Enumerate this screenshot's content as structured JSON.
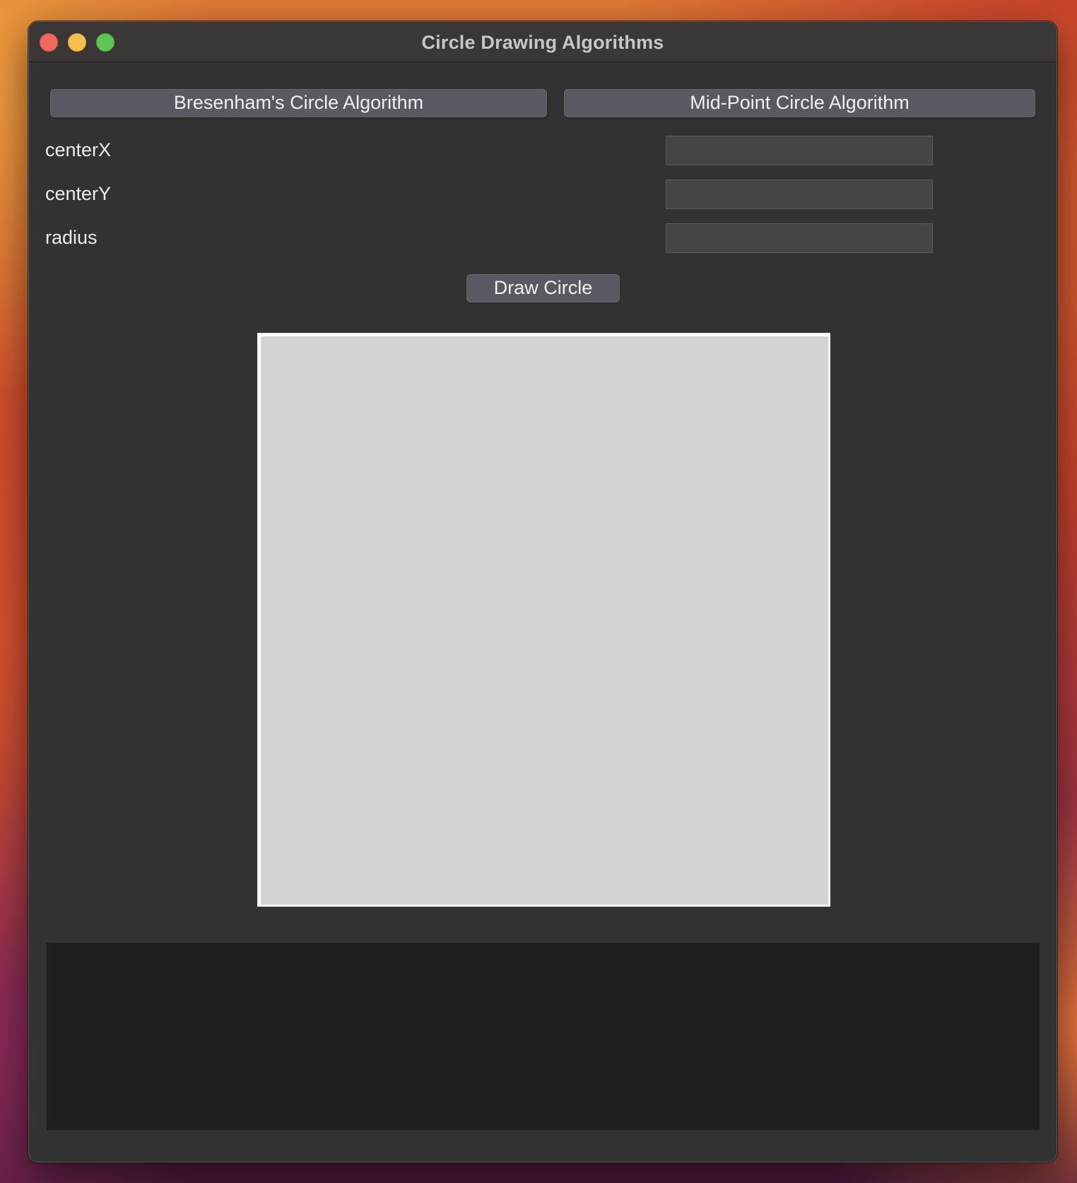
{
  "window": {
    "title": "Circle Drawing Algorithms"
  },
  "toolbar": {
    "bresenham_label": "Bresenham's Circle Algorithm",
    "midpoint_label": "Mid-Point Circle Algorithm"
  },
  "form": {
    "center_x_label": "centerX",
    "center_y_label": "centerY",
    "radius_label": "radius",
    "center_x_value": "",
    "center_y_value": "",
    "radius_value": "",
    "draw_label": "Draw Circle"
  },
  "colors": {
    "window_bg": "#323232",
    "canvas_bg": "#d4d4d4",
    "console_bg": "#1e1e1e",
    "close": "#ee6a5e",
    "minimize": "#f5bf4f",
    "maximize": "#61c554"
  },
  "icons": [
    "close-icon",
    "minimize-icon",
    "maximize-icon"
  ]
}
